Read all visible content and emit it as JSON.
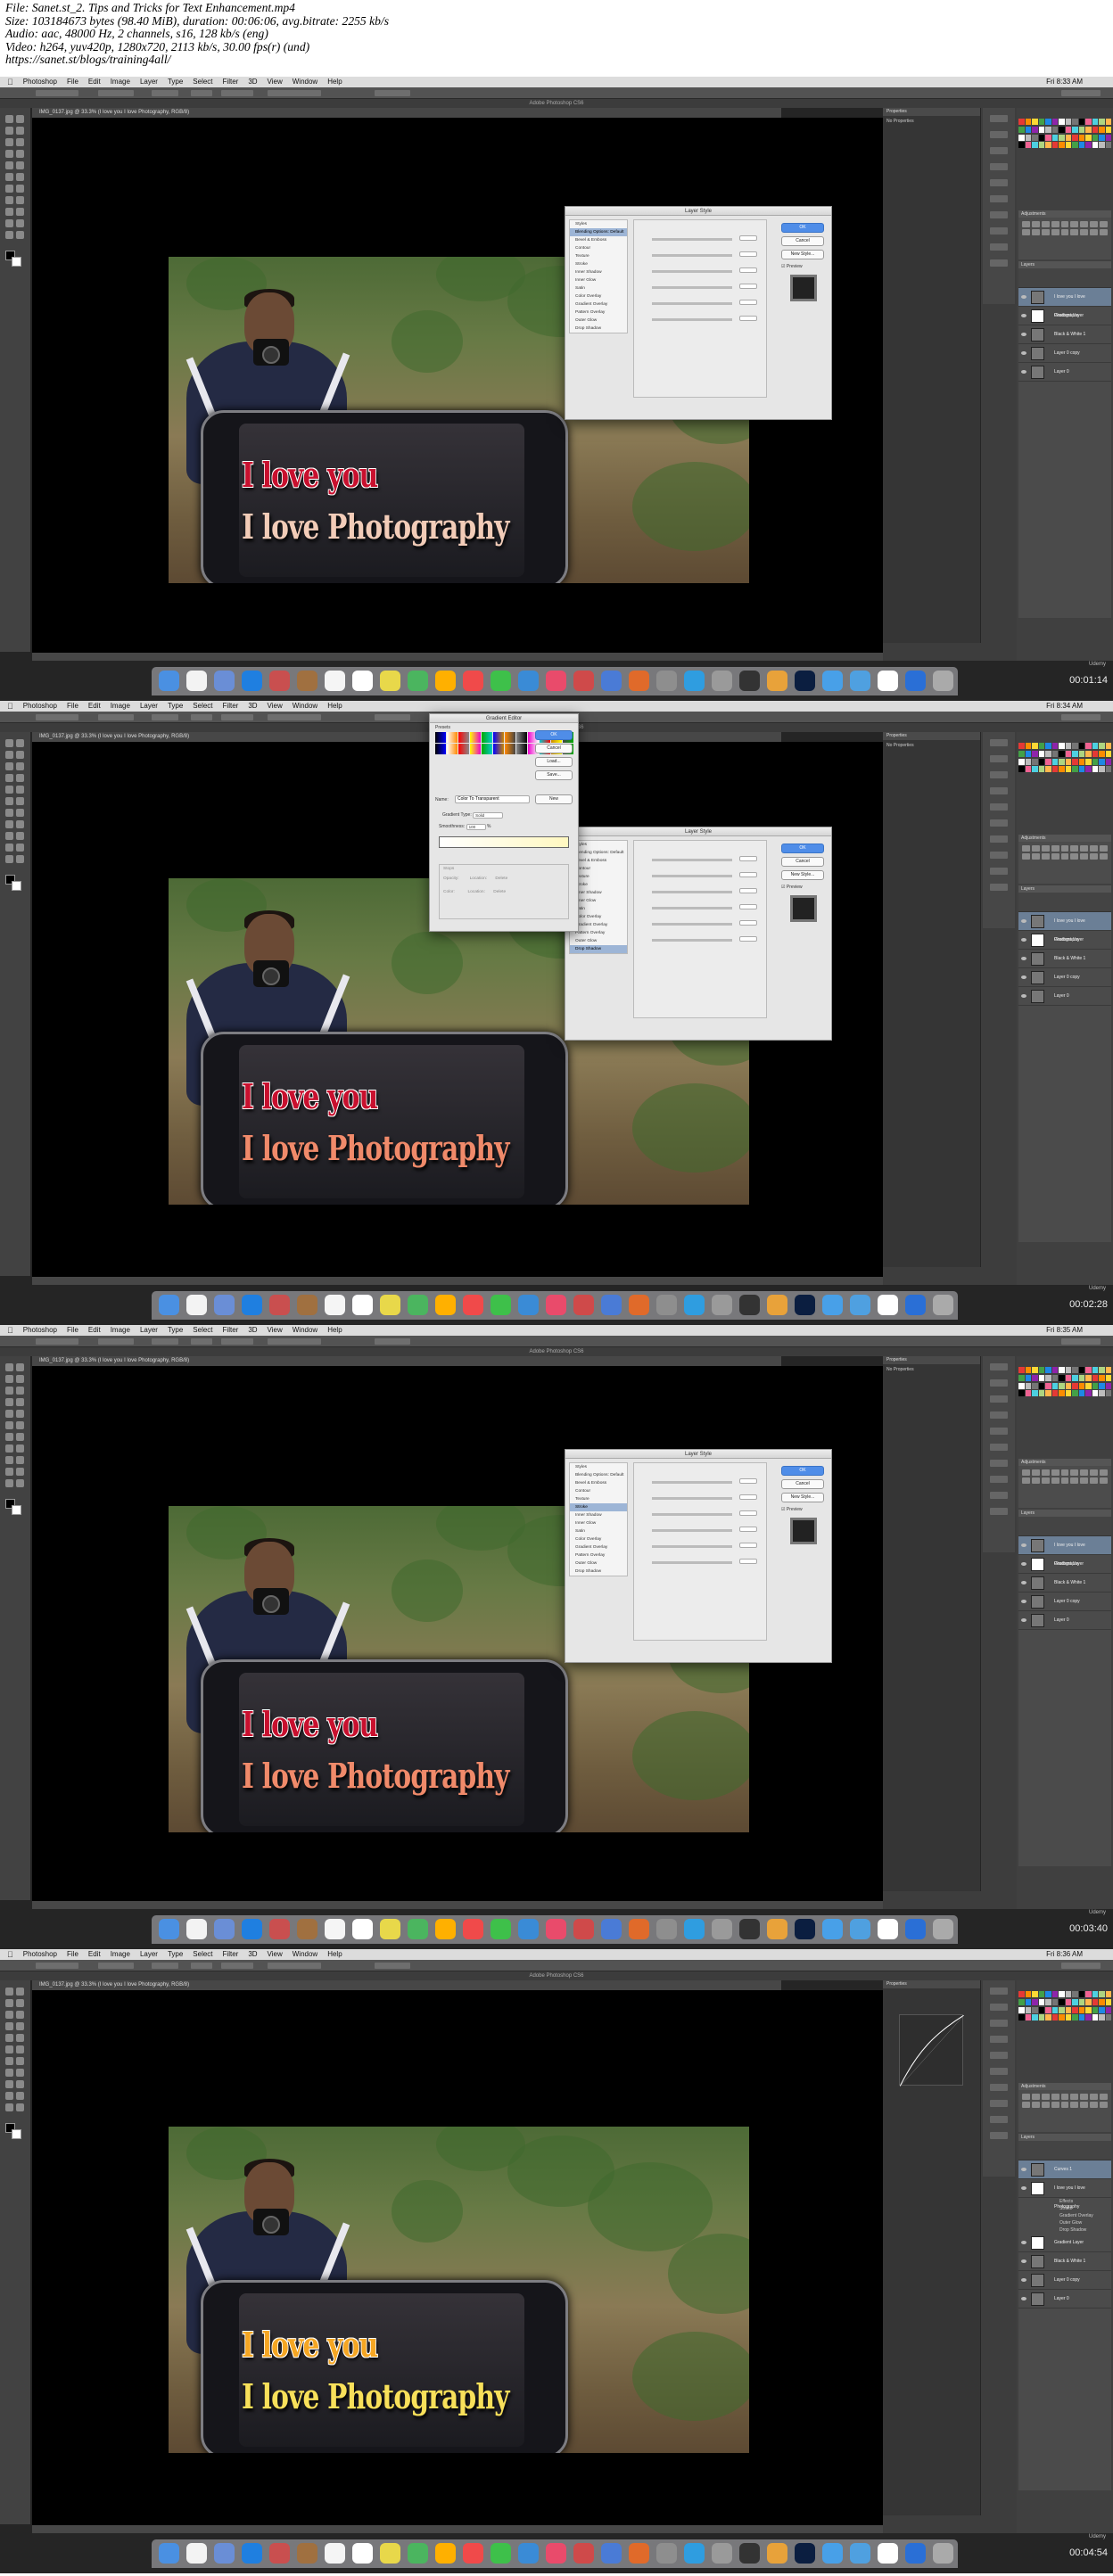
{
  "header": {
    "lines": [
      "File: Sanet.st_2. Tips and Tricks for Text Enhancement.mp4",
      "Size: 103184673 bytes (98.40 MiB), duration: 00:06:06, avg.bitrate: 2255 kb/s",
      "Audio: aac, 48000 Hz, 2 channels, s16, 128 kb/s (eng)",
      "Video: h264, yuv420p, 1280x720, 2113 kb/s, 30.00 fps(r) (und)",
      "https://sanet.st/blogs/training4all/"
    ]
  },
  "app": {
    "menus": [
      "Photoshop",
      "File",
      "Edit",
      "Image",
      "Layer",
      "Type",
      "Select",
      "Filter",
      "3D",
      "View",
      "Window",
      "Help"
    ],
    "window_title": "Adobe Photoshop CS6",
    "document_tab": "IMG_0137.jpg @ 33.3% (I love you I love Photography, RGB/8)",
    "properties_label": "Properties",
    "no_properties": "No Properties",
    "adjustments_label": "Adjustments",
    "layers_label": "Layers",
    "watermark": "Udemy"
  },
  "photo": {
    "line1": "I love you",
    "line2": "I love Photography"
  },
  "layers": [
    {
      "name": "I love you I love Photography",
      "selected": true
    },
    {
      "name": "Gradient Layer",
      "selected": false
    },
    {
      "name": "Black & White 1",
      "selected": false
    },
    {
      "name": "Layer 0 copy",
      "selected": false
    },
    {
      "name": "Layer 0",
      "selected": false
    }
  ],
  "curves_layers": [
    {
      "name": "Curves 1",
      "selected": true
    },
    {
      "name": "I love you I love Photography",
      "selected": false
    },
    {
      "name": "Effects",
      "selected": false
    },
    {
      "name": "Stroke",
      "selected": false
    },
    {
      "name": "Gradient Overlay",
      "selected": false
    },
    {
      "name": "Outer Glow",
      "selected": false
    },
    {
      "name": "Drop Shadow",
      "selected": false
    },
    {
      "name": "Gradient Layer",
      "selected": false
    },
    {
      "name": "Black & White 1",
      "selected": false
    },
    {
      "name": "Layer 0 copy",
      "selected": false
    },
    {
      "name": "Layer 0",
      "selected": false
    }
  ],
  "layer_style": {
    "title": "Layer Style",
    "items": [
      "Styles",
      "Blending Options: Default",
      "Bevel & Emboss",
      "Contour",
      "Texture",
      "Stroke",
      "Inner Shadow",
      "Inner Glow",
      "Satin",
      "Color Overlay",
      "Gradient Overlay",
      "Pattern Overlay",
      "Outer Glow",
      "Drop Shadow"
    ],
    "ok": "OK",
    "cancel": "Cancel",
    "new_style": "New Style...",
    "preview": "Preview"
  },
  "gradient_editor": {
    "title": "Gradient Editor",
    "presets": "Presets",
    "ok": "OK",
    "cancel": "Cancel",
    "load": "Load...",
    "save": "Save...",
    "name_label": "Name:",
    "name_value": "Color To Transparent",
    "new_btn": "New",
    "type_label": "Gradient Type:",
    "type_value": "Solid",
    "smooth_label": "Smoothness:",
    "smooth_value": "100",
    "stops": "Stops",
    "opacity_label": "Opacity:",
    "color_label": "Color:",
    "location_label": "Location:",
    "delete_btn": "Delete"
  },
  "frames": [
    {
      "timestamp": "00:01:14",
      "clock": "Fri 8:33 AM",
      "text1_color": "#c8102e",
      "text2_color": "#f2ccb8"
    },
    {
      "timestamp": "00:02:28",
      "clock": "Fri 8:34 AM",
      "text1_color": "#c8102e",
      "text2_color": "#f08a6a"
    },
    {
      "timestamp": "00:03:40",
      "clock": "Fri 8:35 AM",
      "text1_color": "#c8102e",
      "text2_color": "#f08a6a"
    },
    {
      "timestamp": "00:04:54",
      "clock": "Fri 8:36 AM",
      "text1_color": "#f5a623",
      "text2_color": "#f8e05a"
    }
  ]
}
